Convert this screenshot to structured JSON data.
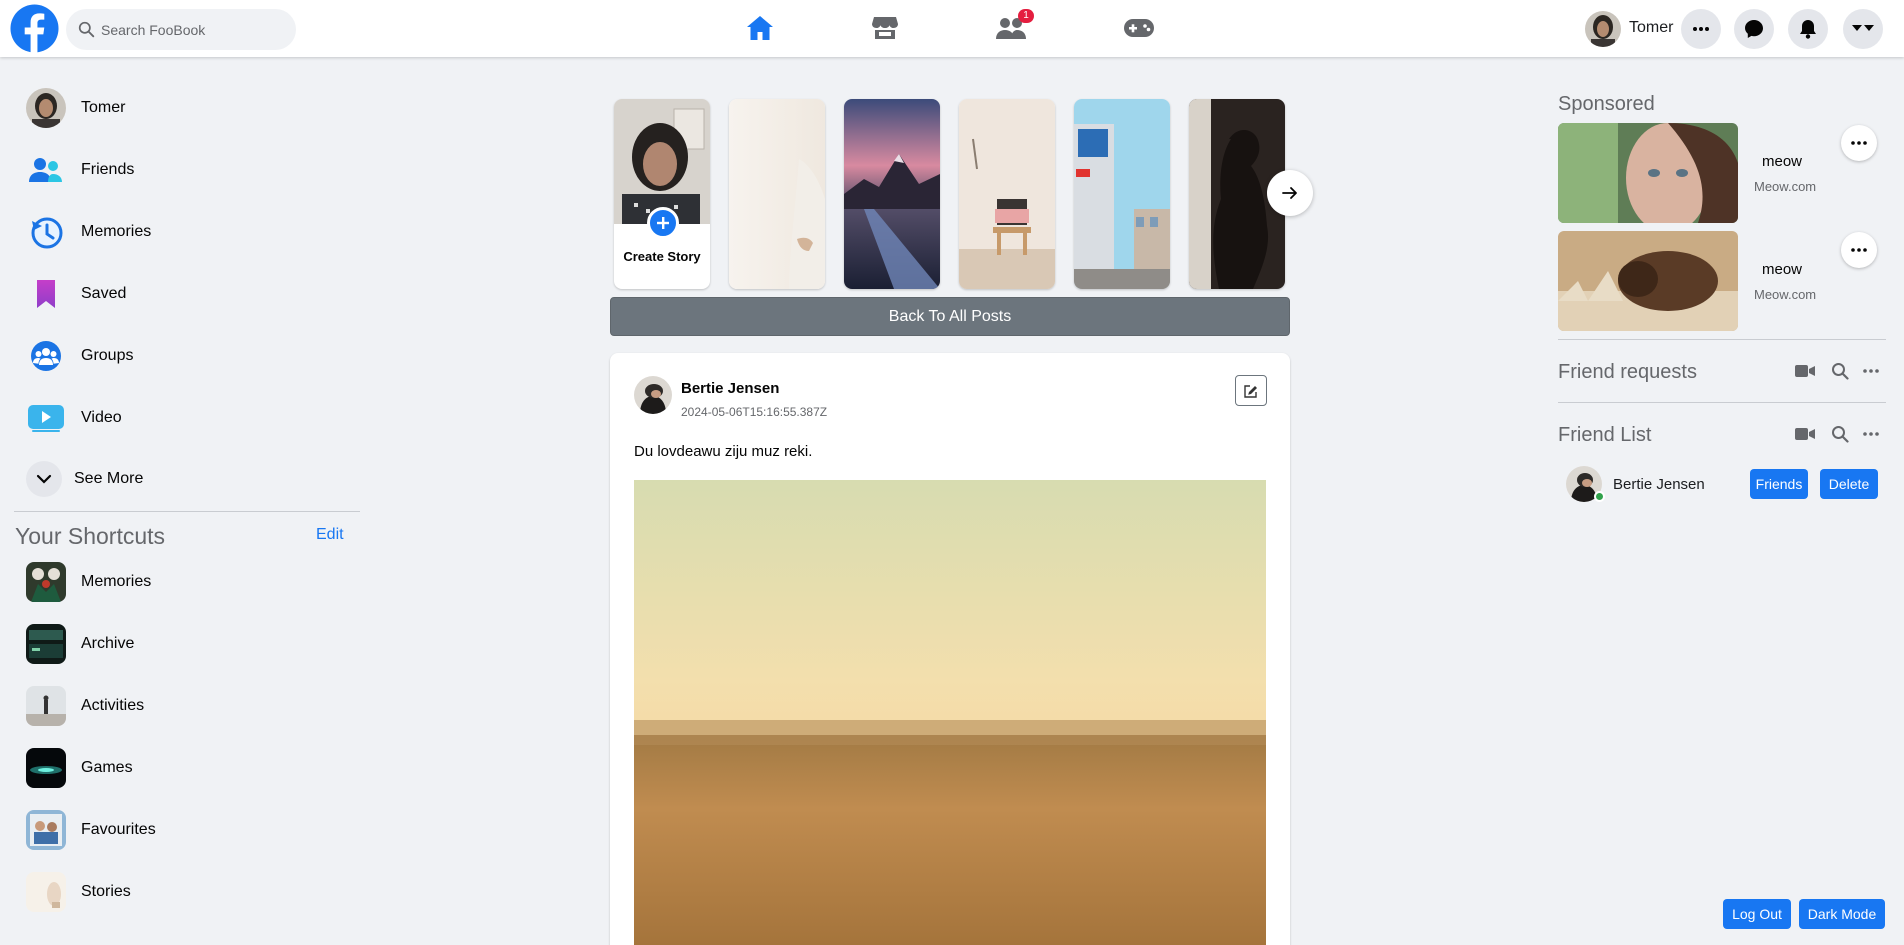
{
  "header": {
    "search_placeholder": "Search FooBook",
    "friends_badge": "1",
    "user_name": "Tomer",
    "brand_color": "#1877f2"
  },
  "sidebar": {
    "items": [
      {
        "label": "Tomer",
        "icon": "user-avatar"
      },
      {
        "label": "Friends",
        "icon": "friends-icon"
      },
      {
        "label": "Memories",
        "icon": "memories-clock-icon"
      },
      {
        "label": "Saved",
        "icon": "bookmark-icon"
      },
      {
        "label": "Groups",
        "icon": "groups-icon"
      },
      {
        "label": "Video",
        "icon": "video-icon"
      },
      {
        "label": "See More",
        "icon": "chevron-down-icon"
      }
    ],
    "shortcuts_title": "Your Shortcuts",
    "shortcuts_edit": "Edit",
    "shortcuts": [
      {
        "label": "Memories"
      },
      {
        "label": "Archive"
      },
      {
        "label": "Activities"
      },
      {
        "label": "Games"
      },
      {
        "label": "Favourites"
      },
      {
        "label": "Stories"
      }
    ]
  },
  "stories": {
    "create_label": "Create Story"
  },
  "feed": {
    "back_button": "Back To All Posts",
    "post": {
      "author": "Bertie Jensen",
      "timestamp": "2024-05-06T15:16:55.387Z",
      "text": "Du lovdeawu ziju muz reki."
    }
  },
  "right": {
    "sponsored_title": "Sponsored",
    "ads": [
      {
        "name": "meow",
        "site": "Meow.com"
      },
      {
        "name": "meow",
        "site": "Meow.com"
      }
    ],
    "friend_requests_title": "Friend requests",
    "friend_list_title": "Friend List",
    "friends": [
      {
        "name": "Bertie Jensen",
        "friends_button": "Friends",
        "delete_button": "Delete"
      }
    ]
  },
  "footer": {
    "logout": "Log Out",
    "dark_mode": "Dark Mode"
  }
}
